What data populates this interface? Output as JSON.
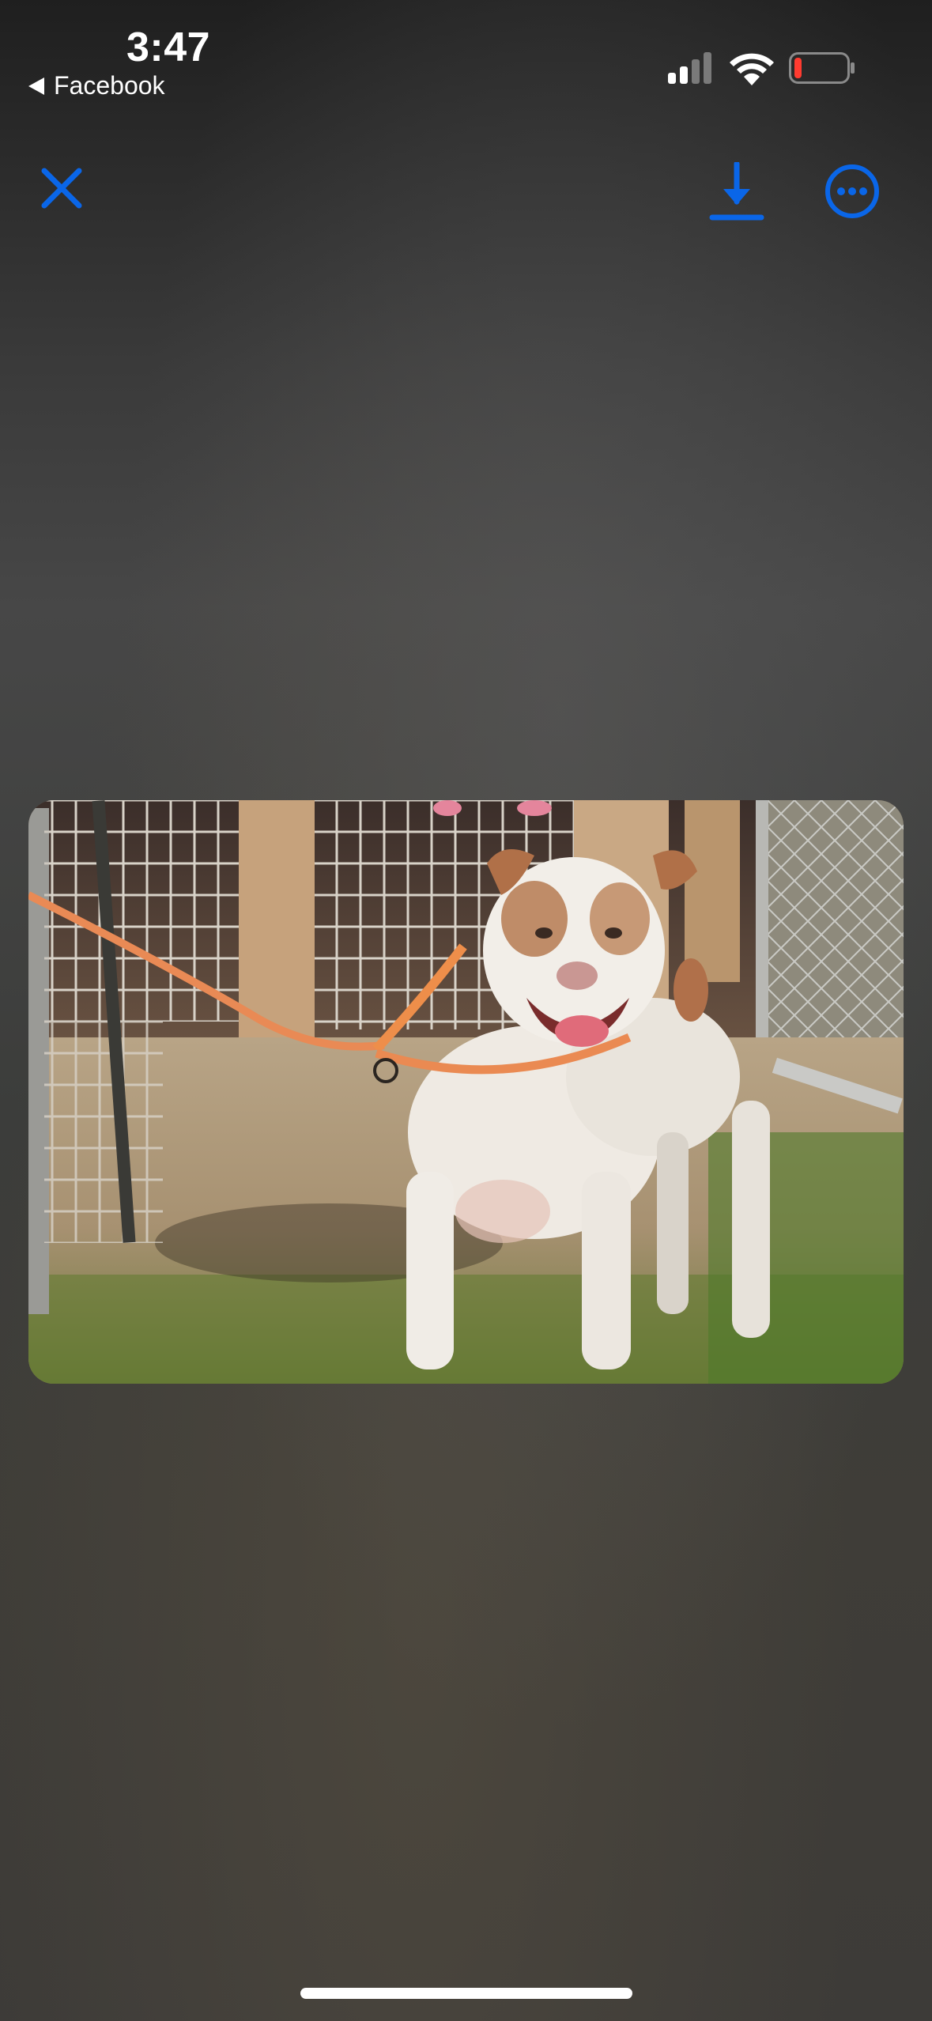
{
  "status_bar": {
    "time": "3:47",
    "back_app_label": "Facebook",
    "signal_icon": "cellular-signal-icon",
    "wifi_icon": "wifi-icon",
    "battery_icon": "battery-low-icon",
    "battery_color": "#ff3b30"
  },
  "toolbar": {
    "close_icon": "close-icon",
    "download_icon": "download-icon",
    "more_icon": "more-options-icon",
    "accent_color": "#0a66e8"
  },
  "photo": {
    "subject": "dog-photo"
  }
}
